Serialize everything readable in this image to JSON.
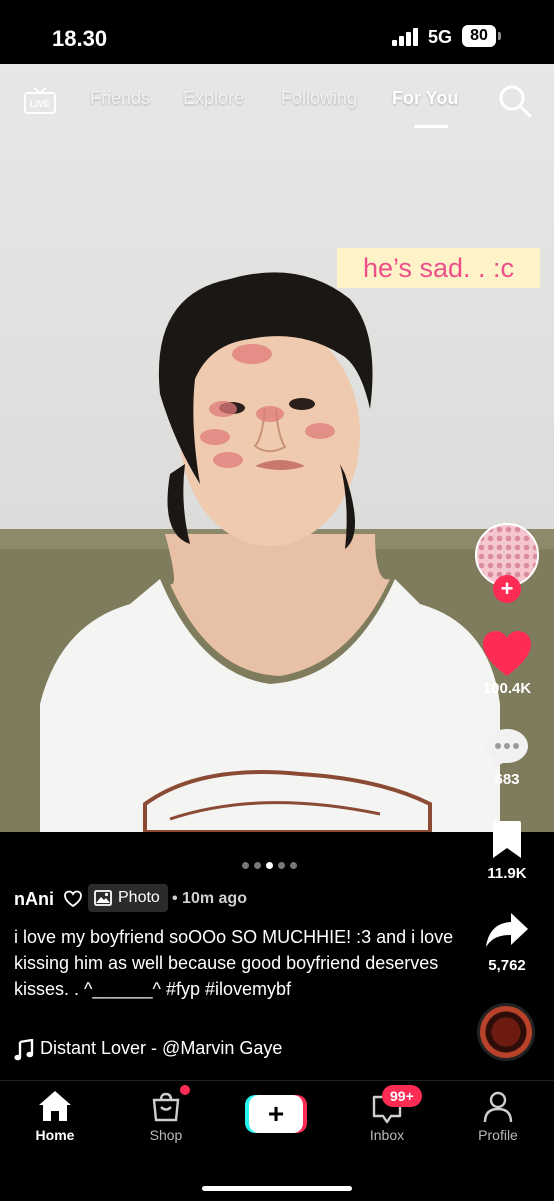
{
  "status_bar": {
    "time": "18.30",
    "network": "5G",
    "battery": "80"
  },
  "top_nav": {
    "live_label": "LIVE",
    "tabs": [
      "Friends",
      "Explore",
      "Following",
      "For You"
    ],
    "active_tab": "For You"
  },
  "photo": {
    "overlay_text": "he’s sad. . :c"
  },
  "actions": {
    "likes": "100.4K",
    "comments": "683",
    "saves": "11.9K",
    "shares": "5,762"
  },
  "carousel": {
    "count": 5,
    "active": 2
  },
  "post": {
    "author": "nAni",
    "type_badge": "Photo",
    "time": "• 10m ago",
    "description": "i love my boyfriend soOOo SO MUCHHIE! :3 and i love kissing him as well because good boyfriend deserves kisses. . ^______^ #fyp #ilovemybf",
    "sound": "Distant Lover - @Marvin Gaye"
  },
  "tab_bar": {
    "items": [
      "Home",
      "Shop",
      "",
      "Inbox",
      "Profile"
    ],
    "active": "Home",
    "inbox_badge": "99+"
  },
  "colors": {
    "accent": "#fe2c55",
    "cyan": "#25f4ee",
    "overlay_bg": "#fdf2c8",
    "overlay_text": "#ee4f8b"
  }
}
